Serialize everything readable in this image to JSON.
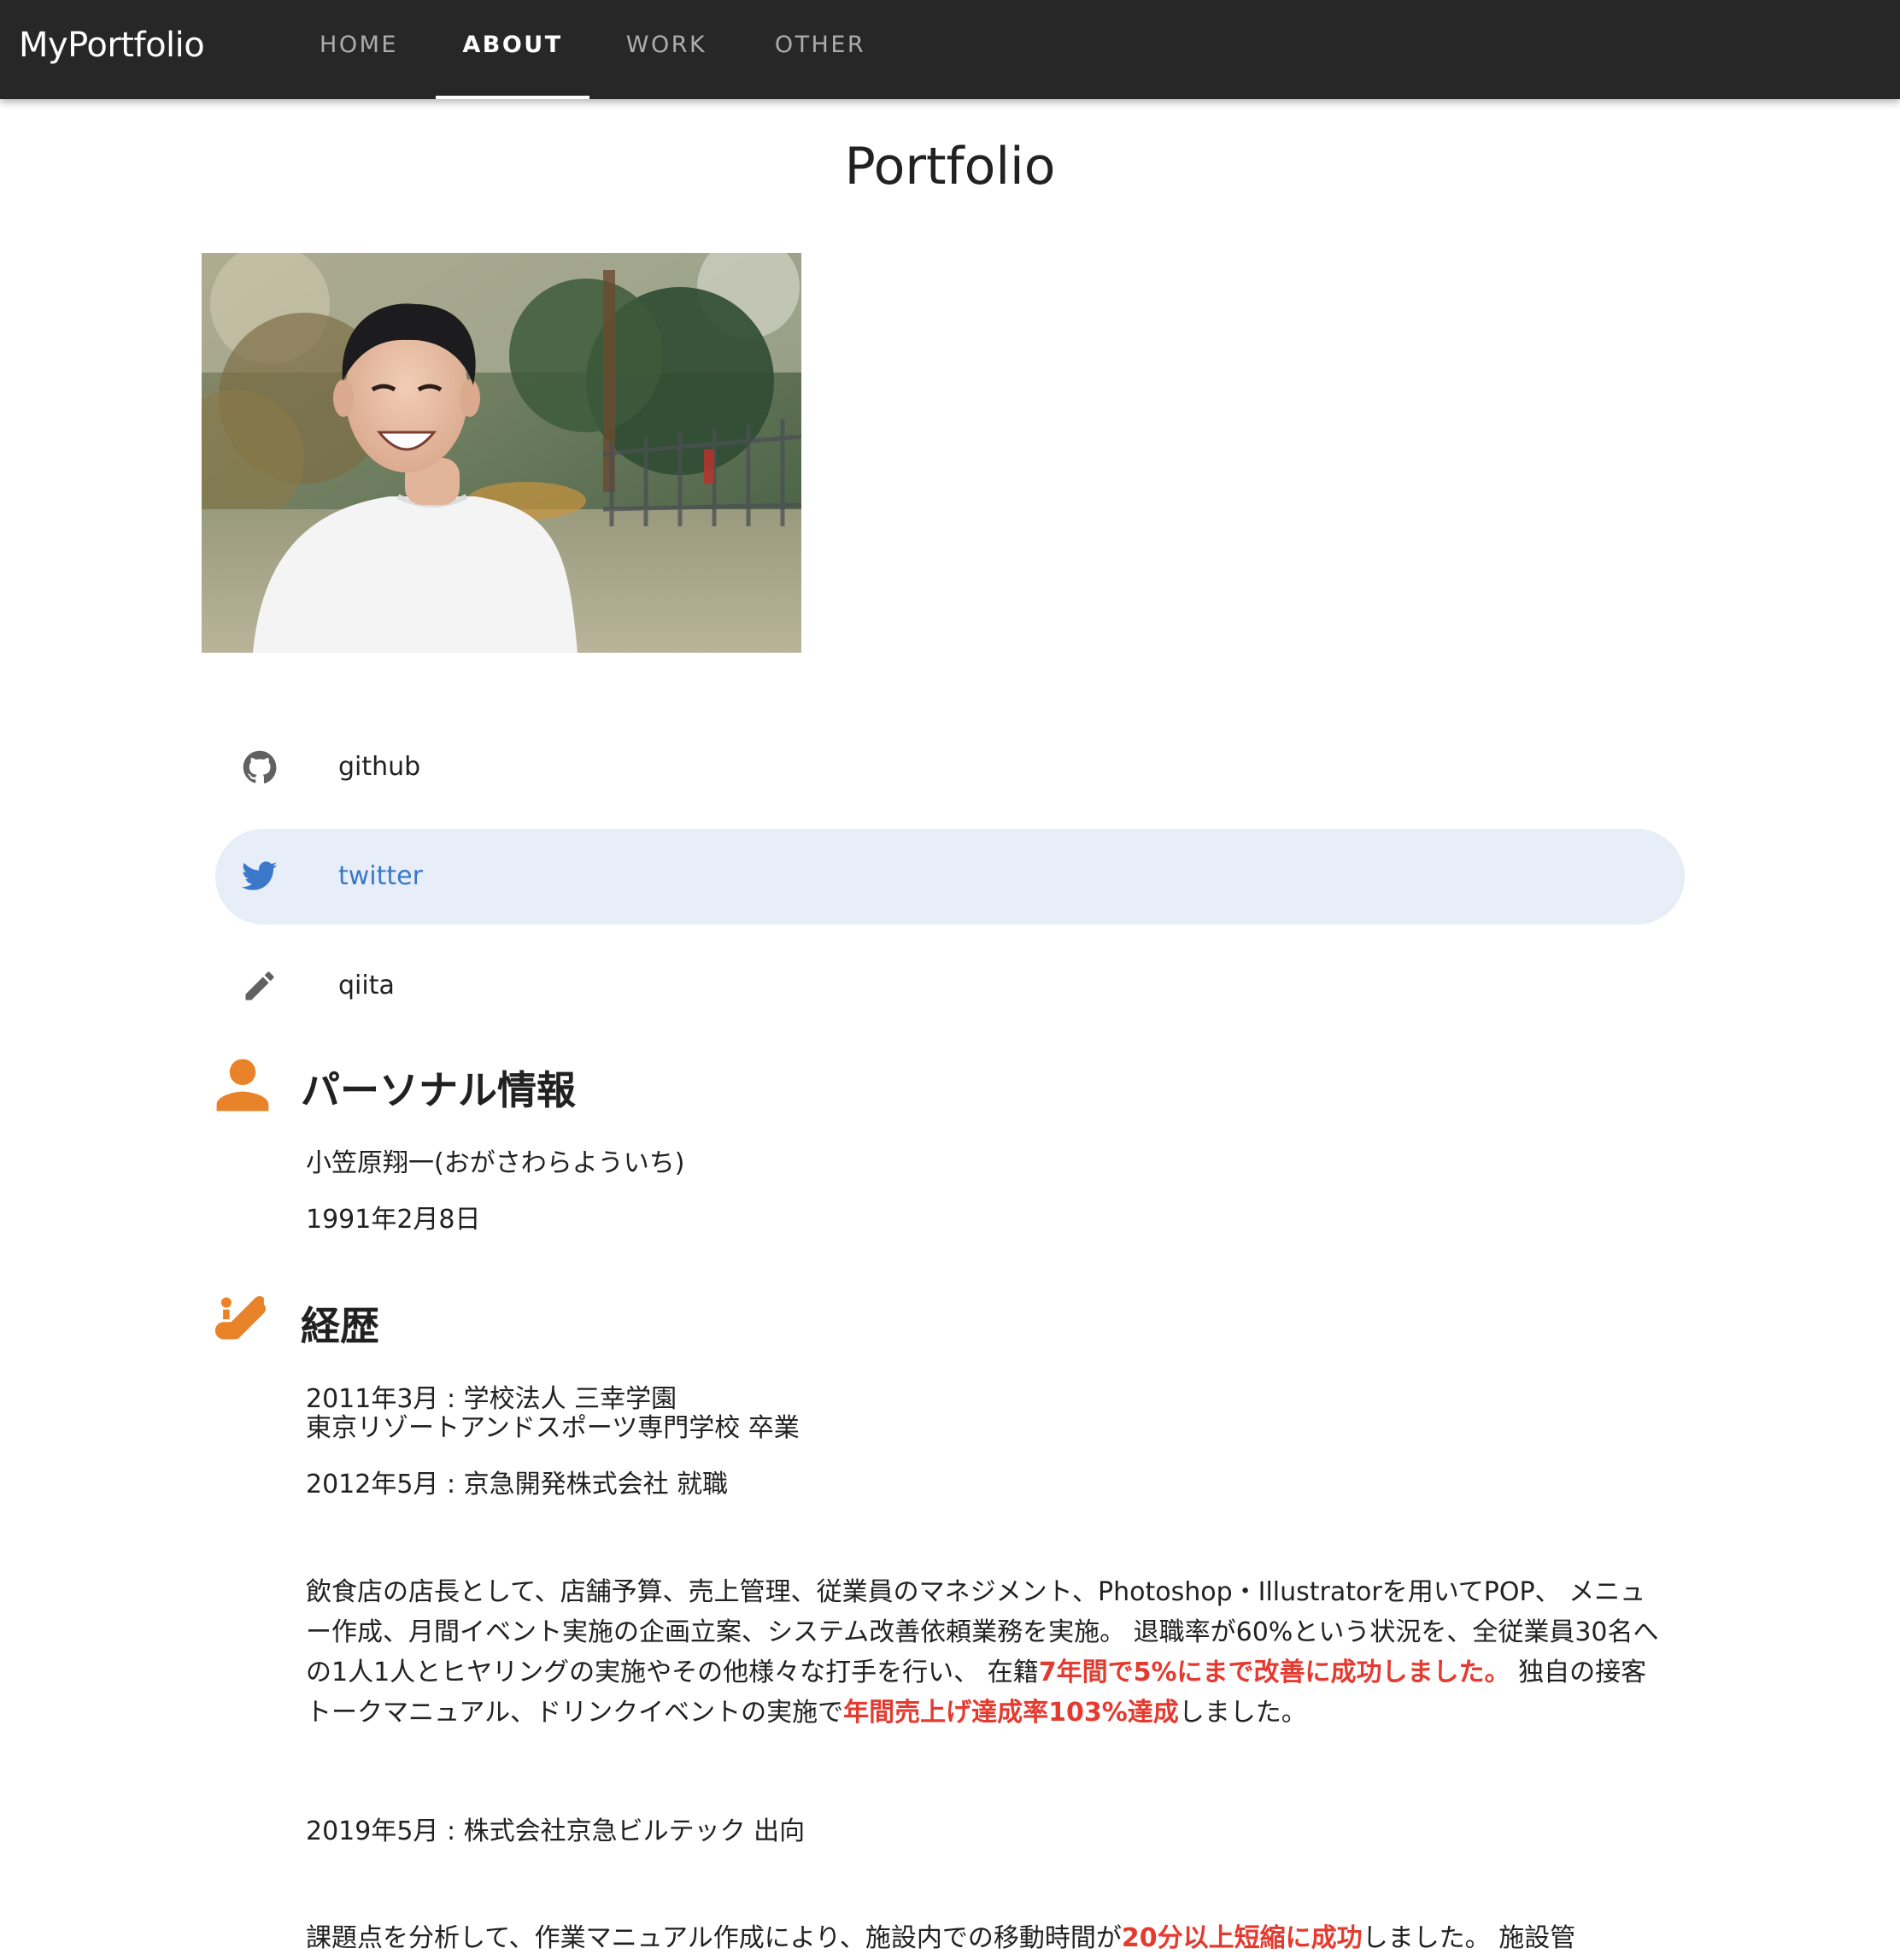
{
  "appbar": {
    "brand": "MyPortfolio",
    "tabs": [
      {
        "label": "HOME",
        "active": false
      },
      {
        "label": "ABOUT",
        "active": true
      },
      {
        "label": "WORK",
        "active": false
      },
      {
        "label": "OTHER",
        "active": false
      }
    ]
  },
  "page": {
    "title": "Portfolio"
  },
  "links": [
    {
      "label": "github",
      "icon": "github-icon"
    },
    {
      "label": "twitter",
      "icon": "twitter-icon",
      "selected": true
    },
    {
      "label": "qiita",
      "icon": "pencil-icon"
    }
  ],
  "personal": {
    "heading": "パーソナル情報",
    "icon": "person-icon",
    "name": "小笠原翔一(おがさわらよういち)",
    "birthday": "1991年2月8日"
  },
  "career": {
    "heading": "経歴",
    "icon": "escalator-icon",
    "entry1_line1": "2011年3月 : 学校法人 三幸学園",
    "entry1_line2": "東京リゾートアンドスポーツ専門学校 卒業",
    "entry2": "2012年5月 : 京急開発株式会社 就職",
    "para1": {
      "t1": "飲食店の店長として、店舗予算、売上管理、従業員のマネジメント、Photoshop・Illustratorを用いてPOP、 メニュー作成、月間イベント実施の企画立案、システム改善依頼業務を実施。 退職率が60%という状況を、全従業員30名への1人1人とヒヤリングの実施やその他様々な打手を行い、 在籍",
      "h1": "7年間で5%にまで改善に成功しました。",
      "t2": " 独自の接客トークマニュアル、ドリンクイベントの実施で",
      "h2": "年間売上げ達成率103%達成",
      "t3": "しました。"
    },
    "entry3": "2019年5月 : 株式会社京急ビルテック 出向",
    "para2": {
      "t1": "課題点を分析して、作業マニュアル作成により、施設内での移動時間が",
      "h1": "20分以上短縮に成功",
      "t2": "しました。 施設管"
    }
  },
  "colors": {
    "appbar_bg": "#272727",
    "accent_orange": "#e8832a",
    "link_blue": "#3b78c9",
    "selected_bg": "#e7eef8",
    "highlight_red": "#e53a2f"
  }
}
